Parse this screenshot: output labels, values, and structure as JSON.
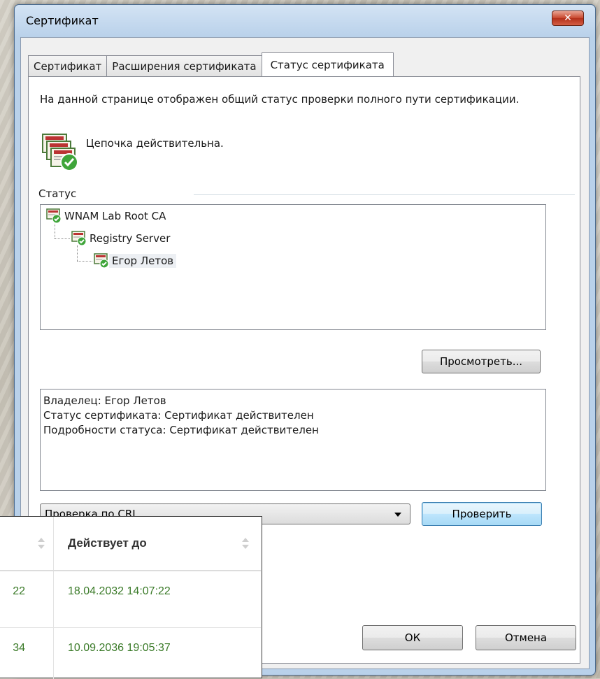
{
  "dialog": {
    "title": "Сертификат",
    "close_glyph": "✕"
  },
  "tabs": [
    {
      "label": "Сертификат",
      "active": false
    },
    {
      "label": "Расширения сертификата",
      "active": false
    },
    {
      "label": "Статус сертификата",
      "active": true
    }
  ],
  "status_page": {
    "description": "На данной странице отображен общий статус проверки полного пути сертификации.",
    "chain_status": "Цепочка действительна.",
    "group_label": "Статус",
    "tree": [
      {
        "label": "WNAM Lab Root CA",
        "level": 0,
        "selected": false
      },
      {
        "label": "Registry Server",
        "level": 1,
        "selected": false
      },
      {
        "label": "Егор Летов",
        "level": 2,
        "selected": true
      }
    ],
    "view_button": "Просмотреть...",
    "details_lines": [
      "Владелец: Егор Летов",
      "Статус сертификата: Сертификат действителен",
      "Подробности статуса: Сертификат действителен"
    ],
    "combo_value": "Проверка по CRL",
    "verify_button": "Проверить"
  },
  "footer": {
    "ok_button": "ОК",
    "cancel_button": "Отмена"
  },
  "overlay_table": {
    "header_valid_until": "Действует до",
    "rows": [
      {
        "col1_fragment": "22",
        "valid_until": "18.04.2032 14:07:22"
      },
      {
        "col1_fragment": "34",
        "valid_until": "10.09.2036 19:05:37"
      }
    ],
    "value_color": "#3a7a28"
  },
  "icons": {
    "close": "close-icon",
    "chain": "certificate-chain-valid-icon",
    "tree_node": "certificate-valid-icon",
    "combo": "chevron-down-icon",
    "sort": "sort-icon"
  }
}
